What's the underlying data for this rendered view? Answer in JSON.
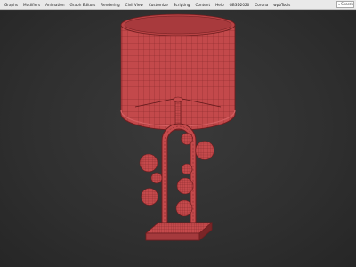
{
  "menubar": {
    "items": [
      {
        "label": "Graphs"
      },
      {
        "label": "Modifiers"
      },
      {
        "label": "Animation"
      },
      {
        "label": "Graph Editors"
      },
      {
        "label": "Rendering"
      },
      {
        "label": "Civil View"
      },
      {
        "label": "Customize"
      },
      {
        "label": "Scripting"
      },
      {
        "label": "Content"
      },
      {
        "label": "Help"
      },
      {
        "label": "GB3D2020"
      },
      {
        "label": "Corona"
      },
      {
        "label": "wpbTools"
      }
    ],
    "search_label": "Search"
  },
  "viewport": {
    "model": "table-lamp-wireframe",
    "colors": {
      "fill": "#c3494b",
      "wire": "#6e1d1f",
      "background": "#2f2f2f"
    }
  }
}
